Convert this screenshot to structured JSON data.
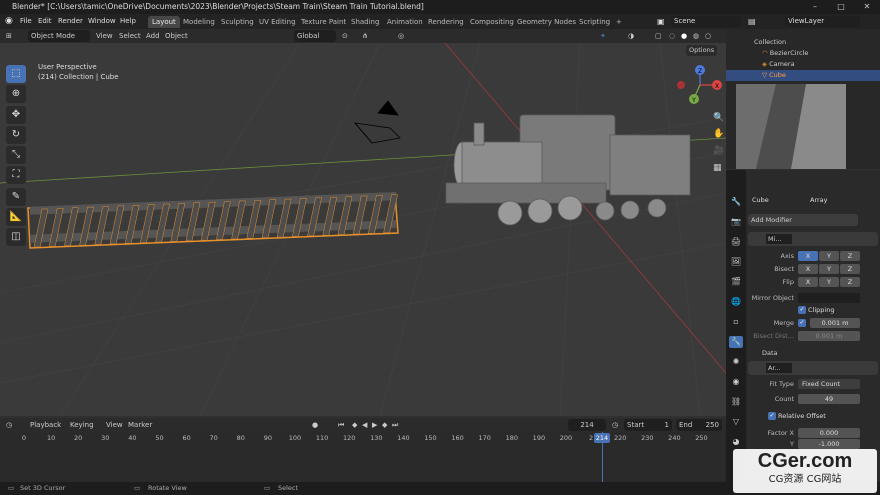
{
  "title": "Blender* [C:\\Users\\tamic\\OneDrive\\Documents\\2023\\Blender\\Projects\\Steam Train\\Steam Train Tutorial.blend]",
  "menu": [
    "File",
    "Edit",
    "Render",
    "Window",
    "Help"
  ],
  "workspaces": [
    "Layout",
    "Modeling",
    "Sculpting",
    "UV Editing",
    "Texture Paint",
    "Shading",
    "Animation",
    "Rendering",
    "Compositing",
    "Geometry Nodes",
    "Scripting"
  ],
  "scene": "Scene",
  "view_layer": "ViewLayer",
  "viewport": {
    "mode": "Object Mode",
    "menus": [
      "View",
      "Select",
      "Add",
      "Object"
    ],
    "orientation": "Global",
    "options": "Options",
    "perspective": "User Perspective",
    "collection_info": "(214) Collection | Cube",
    "gizmo": {
      "x": "X",
      "y": "Y",
      "z": "Z"
    }
  },
  "outliner": {
    "rows": [
      {
        "label": "Collection"
      },
      {
        "label": "BezierCircle"
      },
      {
        "label": "Camera"
      },
      {
        "label": "Cube",
        "selected": true
      }
    ]
  },
  "properties": {
    "object": "Cube",
    "modifier_tab": "Array",
    "add_modifier": "Add Modifier",
    "mirror": {
      "name": "Mi...",
      "axis_label": "Axis",
      "bisect_label": "Bisect",
      "flip_label": "Flip",
      "x": "X",
      "y": "Y",
      "z": "Z",
      "mirror_object_label": "Mirror Object",
      "clipping": "Clipping",
      "merge_label": "Merge",
      "merge_value": "0.001 m",
      "bisect_dist_label": "Bisect Dist...",
      "bisect_dist_value": "0.001 m",
      "data": "Data"
    },
    "array": {
      "name": "Ar...",
      "fit_type_label": "Fit Type",
      "fit_type_value": "Fixed Count",
      "count_label": "Count",
      "count_value": "49",
      "relative_offset": "Relative Offset",
      "factor_x_label": "Factor X",
      "factor_x_value": "0.000",
      "y_label": "Y",
      "y_value": "-1.000"
    }
  },
  "timeline": {
    "menus": [
      "Playback",
      "Keying",
      "View",
      "Marker"
    ],
    "current_frame": "214",
    "start_label": "Start",
    "start": "1",
    "end_label": "End",
    "end": "250",
    "ticks": [
      "0",
      "10",
      "20",
      "30",
      "40",
      "50",
      "60",
      "70",
      "80",
      "90",
      "100",
      "110",
      "120",
      "130",
      "140",
      "150",
      "160",
      "170",
      "180",
      "190",
      "200",
      "21",
      "220",
      "230",
      "240",
      "250"
    ],
    "playhead_label": "214"
  },
  "status": {
    "left": "Set 3D Cursor",
    "middle": "Rotate View",
    "right": "Select"
  },
  "watermark": {
    "main": "CGer.com",
    "sub": "CG资源 CG网站"
  },
  "colors": {
    "accent": "#4772b3",
    "selection": "#e8902a",
    "bg": "#3a3a3a"
  }
}
